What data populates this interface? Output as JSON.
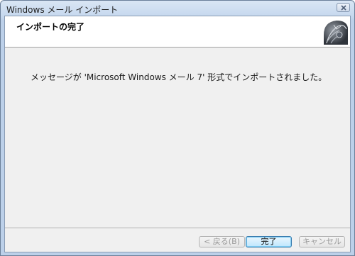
{
  "window": {
    "title": "Windows メール インポート"
  },
  "header": {
    "title": "インポートの完了"
  },
  "main": {
    "message": "メッセージが 'Microsoft Windows メール 7' 形式でインポートされました。"
  },
  "buttons": {
    "back": "< 戻る(B)",
    "finish": "完了",
    "cancel": "キャンセル"
  },
  "icons": {
    "close": "close-icon",
    "wizard": "import-wizard-icon"
  },
  "colors": {
    "titlebar": "#c6d8ee",
    "client_bg": "#f0f0f0",
    "header_bg": "#ffffff",
    "default_button": "#bee6fd"
  }
}
